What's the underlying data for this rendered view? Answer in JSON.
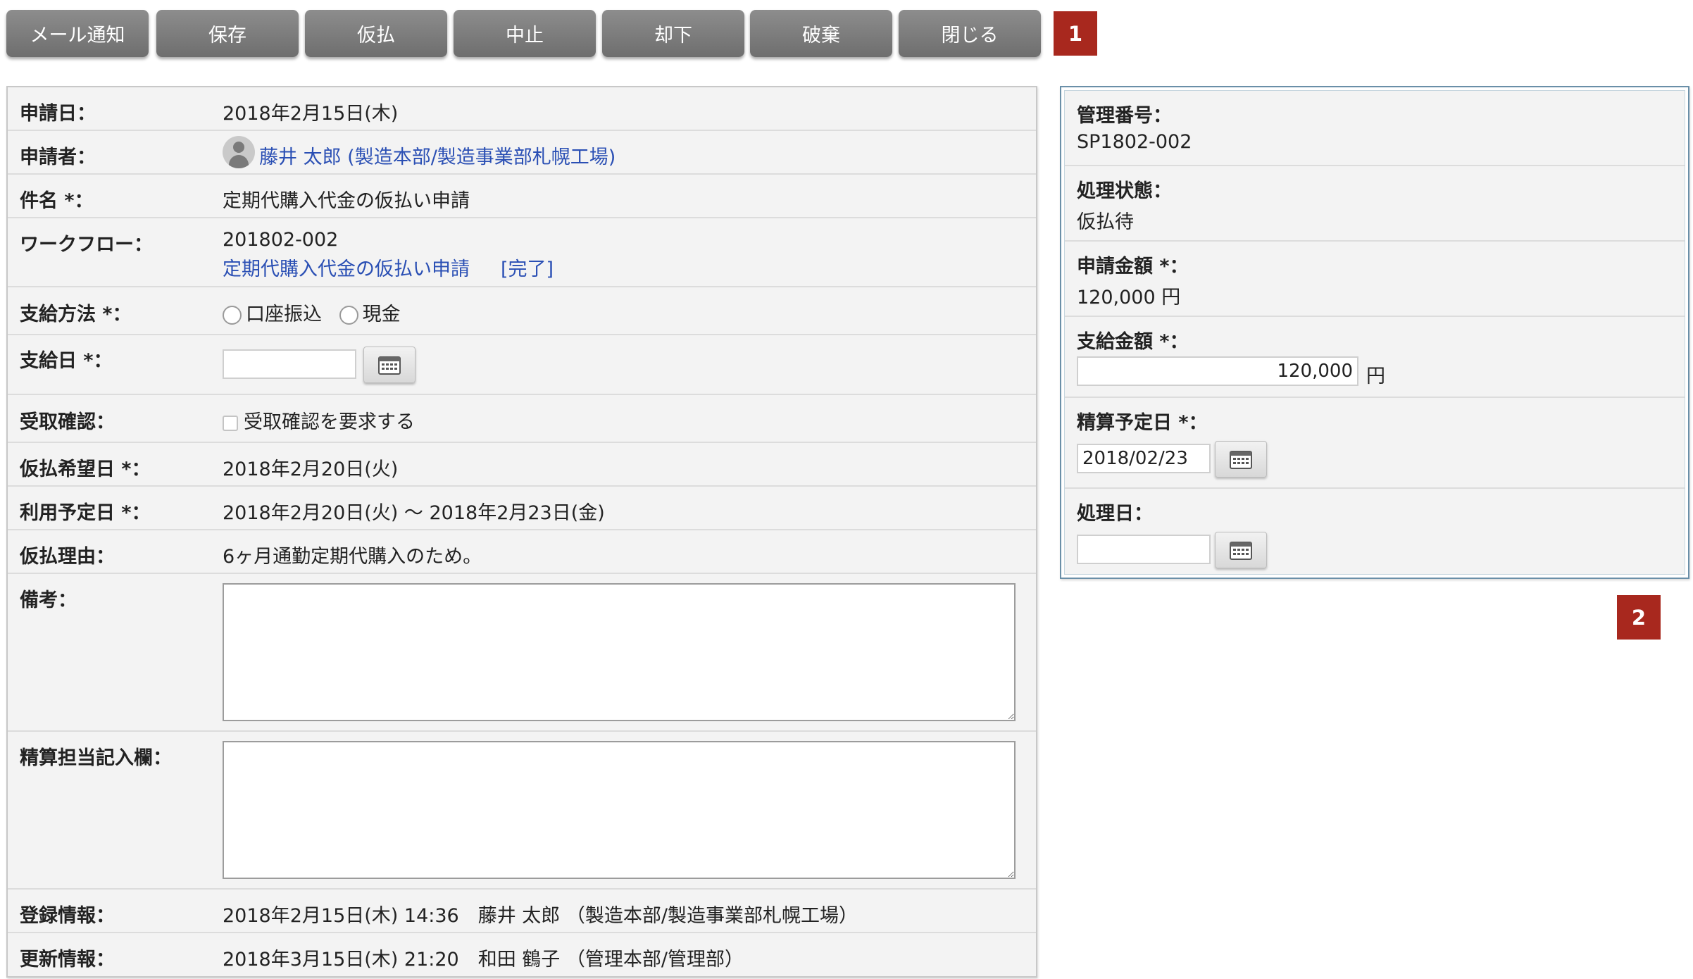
{
  "toolbar": {
    "buttons": [
      "メール通知",
      "保存",
      "仮払",
      "中止",
      "却下",
      "破棄",
      "閉じる"
    ],
    "badge": "1"
  },
  "form": {
    "application_date": {
      "label": "申請日：",
      "value": "2018年2月15日(木)"
    },
    "applicant": {
      "label": "申請者：",
      "value": "藤井 太郎 (製造本部/製造事業部札幌工場)"
    },
    "subject": {
      "label": "件名 *：",
      "value": "定期代購入代金の仮払い申請"
    },
    "workflow": {
      "label": "ワークフロー：",
      "number": "201802-002",
      "link": "定期代購入代金の仮払い申請",
      "status": "[完了]"
    },
    "payment_method": {
      "label": "支給方法 *：",
      "options": [
        "口座振込",
        "現金"
      ]
    },
    "payment_date": {
      "label": "支給日 *：",
      "value": ""
    },
    "receipt_confirm": {
      "label": "受取確認：",
      "checkbox_label": "受取確認を要求する"
    },
    "desired_date": {
      "label": "仮払希望日 *：",
      "value": "2018年2月20日(火)"
    },
    "usage_period": {
      "label": "利用予定日 *：",
      "value": "2018年2月20日(火) 〜 2018年2月23日(金)"
    },
    "reason": {
      "label": "仮払理由：",
      "value": "6ヶ月通勤定期代購入のため。"
    },
    "remarks": {
      "label": "備考：",
      "value": ""
    },
    "accounting_notes": {
      "label": "精算担当記入欄：",
      "value": ""
    },
    "registration": {
      "label": "登録情報：",
      "value": "2018年2月15日(木) 14:36　藤井 太郎 （製造本部/製造事業部札幌工場）"
    },
    "update": {
      "label": "更新情報：",
      "value": "2018年3月15日(木) 21:20　和田 鶴子 （管理本部/管理部）"
    }
  },
  "panel": {
    "control_number": {
      "label": "管理番号：",
      "value": "SP1802-002"
    },
    "status": {
      "label": "処理状態：",
      "value": "仮払待"
    },
    "requested_amount": {
      "label": "申請金額 *：",
      "value": "120,000 円"
    },
    "paid_amount": {
      "label": "支給金額 *：",
      "value": "120,000",
      "unit": "円"
    },
    "settlement_date": {
      "label": "精算予定日 *：",
      "value": "2018/02/23"
    },
    "processed_date": {
      "label": "処理日：",
      "value": ""
    },
    "badge": "2"
  },
  "colors": {
    "button_bg": "#7a7a7a",
    "badge_bg": "#a8281e",
    "link": "#2a4fb4",
    "panel_border": "#6a8fa8"
  }
}
